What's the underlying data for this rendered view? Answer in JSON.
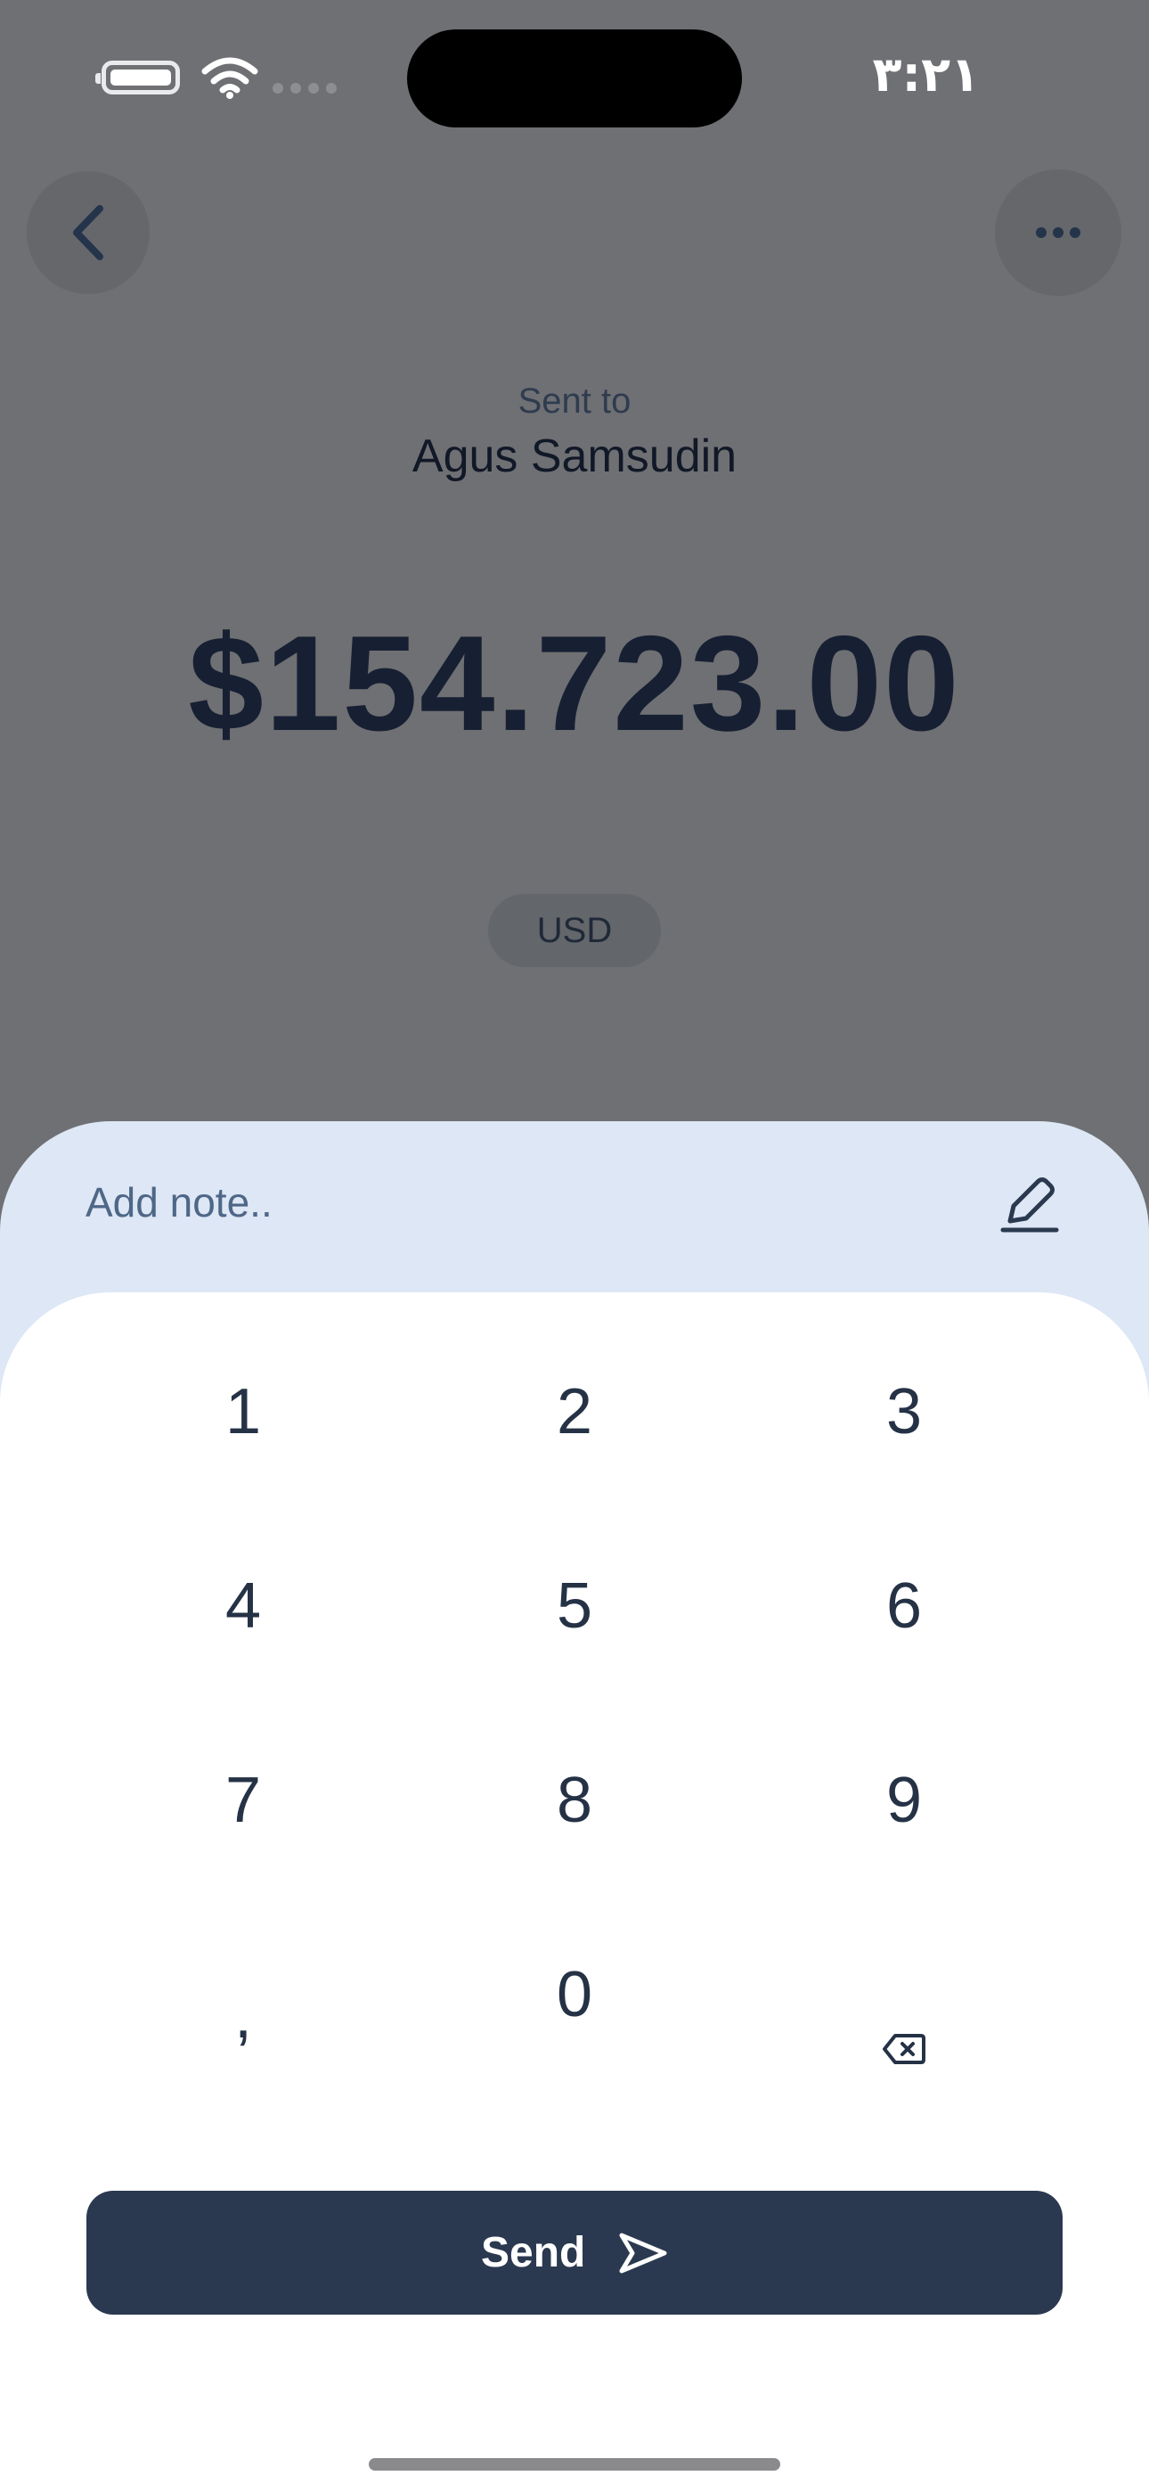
{
  "status_bar": {
    "time": "۳:۲۱",
    "battery_icon": "battery-icon",
    "wifi_icon": "wifi-icon",
    "signal_icon": "signal-dots-icon"
  },
  "header": {
    "back_icon": "chevron-left-icon",
    "more_icon": "ellipsis-icon"
  },
  "transfer": {
    "sent_to_label": "Sent to",
    "recipient_name": "Agus Samsudin",
    "amount": "$154.723.00",
    "currency": "USD"
  },
  "note": {
    "placeholder": "Add note..",
    "edit_icon": "pencil-icon"
  },
  "keypad": {
    "key_1": "1",
    "key_2": "2",
    "key_3": "3",
    "key_4": "4",
    "key_5": "5",
    "key_6": "6",
    "key_7": "7",
    "key_8": "8",
    "key_9": "9",
    "key_comma": ",",
    "key_0": "0",
    "backspace_icon": "backspace-icon"
  },
  "actions": {
    "send_label": "Send",
    "send_icon": "send-icon"
  },
  "colors": {
    "overlay_background": "#6f7073",
    "sheet_header": "#dde7f5",
    "keypad_background": "#ffffff",
    "send_button": "#2b3950",
    "primary_text": "#172033"
  }
}
